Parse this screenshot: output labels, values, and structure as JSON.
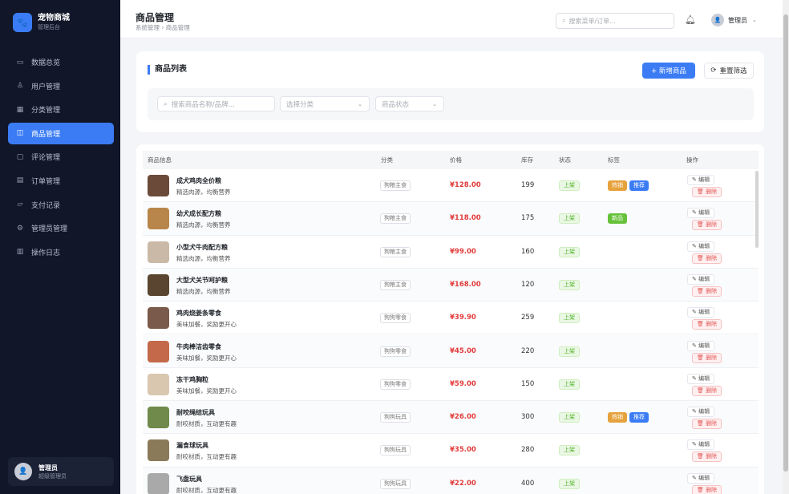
{
  "sidebar": {
    "brand_name": "宠物商城",
    "brand_sub": "管理后台",
    "items": [
      {
        "label": "数据总览",
        "icon": "monitor-icon"
      },
      {
        "label": "用户管理",
        "icon": "user-icon"
      },
      {
        "label": "分类管理",
        "icon": "grid-icon"
      },
      {
        "label": "商品管理",
        "icon": "bag-icon",
        "active": true
      },
      {
        "label": "评论管理",
        "icon": "chat-icon"
      },
      {
        "label": "订单管理",
        "icon": "document-icon"
      },
      {
        "label": "支付记录",
        "icon": "folder-icon"
      },
      {
        "label": "管理员管理",
        "icon": "gear-icon"
      },
      {
        "label": "操作日志",
        "icon": "clipboard-icon"
      }
    ],
    "user": {
      "name": "管理员",
      "role": "超级管理员"
    }
  },
  "header": {
    "title": "商品管理",
    "breadcrumb": "系统管理 › 商品管理",
    "search_placeholder": "搜索菜单/订单...",
    "user_name": "管理员"
  },
  "filter": {
    "list_title": "商品列表",
    "add_label": "+ 新增商品",
    "reset_label": "重置筛选",
    "search_placeholder": "搜索商品名称/品牌...",
    "category_placeholder": "选择分类",
    "status_placeholder": "商品状态"
  },
  "table": {
    "headers": [
      "商品信息",
      "分类",
      "价格",
      "库存",
      "状态",
      "标签",
      "操作"
    ],
    "edit_label": "编辑",
    "delete_label": "删除",
    "rows": [
      {
        "name": "成犬鸡肉全价粮",
        "desc": "精选肉源，均衡营养",
        "category": "狗粮主食",
        "price": "¥128.00",
        "stock": "199",
        "status": "上架",
        "tags": [
          "热销",
          "推荐"
        ],
        "color": "#6b4a3a"
      },
      {
        "name": "幼犬成长配方粮",
        "desc": "精选肉源，均衡营养",
        "category": "狗粮主食",
        "price": "¥118.00",
        "stock": "175",
        "status": "上架",
        "tags": [
          "新品"
        ],
        "color": "#b8864a"
      },
      {
        "name": "小型犬牛肉配方粮",
        "desc": "精选肉源，均衡营养",
        "category": "狗粮主食",
        "price": "¥99.00",
        "stock": "160",
        "status": "上架",
        "tags": [],
        "color": "#c9b9a6"
      },
      {
        "name": "大型犬关节呵护粮",
        "desc": "精选肉源，均衡营养",
        "category": "狗粮主食",
        "price": "¥168.00",
        "stock": "120",
        "status": "上架",
        "tags": [],
        "color": "#5a4630"
      },
      {
        "name": "鸡肉烧姜条零食",
        "desc": "美味加餐，奖励更开心",
        "category": "狗狗零食",
        "price": "¥39.90",
        "stock": "259",
        "status": "上架",
        "tags": [],
        "color": "#7a5a4a"
      },
      {
        "name": "牛肉棒洁齿零食",
        "desc": "美味加餐，奖励更开心",
        "category": "狗狗零食",
        "price": "¥45.00",
        "stock": "220",
        "status": "上架",
        "tags": [],
        "color": "#c46a4a"
      },
      {
        "name": "冻干鸡胸粒",
        "desc": "美味加餐，奖励更开心",
        "category": "狗狗零食",
        "price": "¥59.00",
        "stock": "150",
        "status": "上架",
        "tags": [],
        "color": "#d9c7b0"
      },
      {
        "name": "耐咬绳结玩具",
        "desc": "耐咬材质，互动更有趣",
        "category": "狗狗玩具",
        "price": "¥26.00",
        "stock": "300",
        "status": "上架",
        "tags": [
          "热销",
          "推荐"
        ],
        "color": "#6f8a4a"
      },
      {
        "name": "漏食球玩具",
        "desc": "耐咬材质，互动更有趣",
        "category": "狗狗玩具",
        "price": "¥35.00",
        "stock": "280",
        "status": "上架",
        "tags": [],
        "color": "#8a7a5a"
      },
      {
        "name": "飞盘玩具",
        "desc": "耐咬材质，互动更有趣",
        "category": "狗狗玩具",
        "price": "¥22.00",
        "stock": "400",
        "status": "上架",
        "tags": [],
        "color": "#a9a9a9"
      }
    ]
  },
  "colors": {
    "accent": "#3b7cf5",
    "sidebar_bg": "#111729",
    "price": "#e23b3b",
    "hot": "#e6a23c",
    "new": "#67c23a"
  }
}
